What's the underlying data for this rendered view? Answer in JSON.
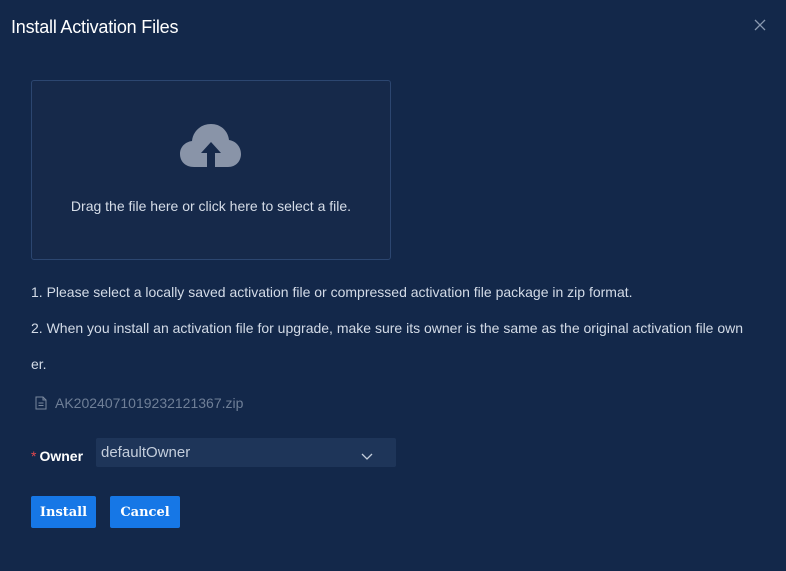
{
  "dialog": {
    "title": "Install Activation Files"
  },
  "upload": {
    "prompt": "Drag the file here or click here to select a file."
  },
  "notes": {
    "line1": "1. Please select a locally saved activation file or compressed activation file package in zip format.",
    "line2": "2. When you install an activation file for upgrade, make sure its owner is the same as the original activation file own",
    "line2_wrap": "er."
  },
  "file": {
    "name": "AK2024071019232121367.zip",
    "icon": "document-icon"
  },
  "owner": {
    "required_mark": "*",
    "label": "Owner",
    "selected": "defaultOwner"
  },
  "buttons": {
    "install": "Install",
    "cancel": "Cancel"
  },
  "colors": {
    "background": "#13284a",
    "accent": "#1677e6",
    "required": "#e5484d"
  }
}
